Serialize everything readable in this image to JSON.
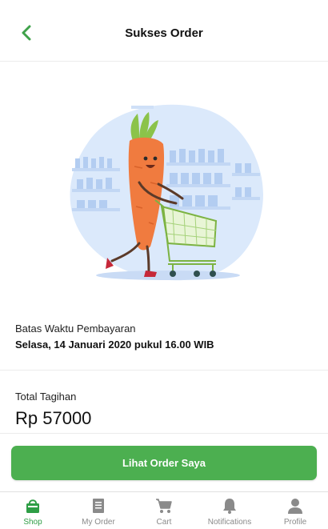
{
  "header": {
    "title": "Sukses Order",
    "back_icon": "chevron-left-icon"
  },
  "colors": {
    "accent": "#4caf50",
    "active_tab": "#2e9e45",
    "inactive_tab": "#8a8a8a"
  },
  "illustration": {
    "description_icon": "carrot-shopping-cart-illustration"
  },
  "deadline": {
    "label": "Batas Waktu Pembayaran",
    "value": "Selasa, 14 Januari 2020 pukul 16.00 WIB"
  },
  "total": {
    "label": "Total Tagihan",
    "value": "Rp 57000"
  },
  "cta": {
    "label": "Lihat Order Saya"
  },
  "tabbar": {
    "active": "Shop",
    "tabs": [
      {
        "label": "Shop",
        "icon": "shopping-bag-icon"
      },
      {
        "label": "My Order",
        "icon": "receipt-icon"
      },
      {
        "label": "Cart",
        "icon": "cart-icon"
      },
      {
        "label": "Notifications",
        "icon": "bell-icon"
      },
      {
        "label": "Profile",
        "icon": "person-icon"
      }
    ]
  }
}
